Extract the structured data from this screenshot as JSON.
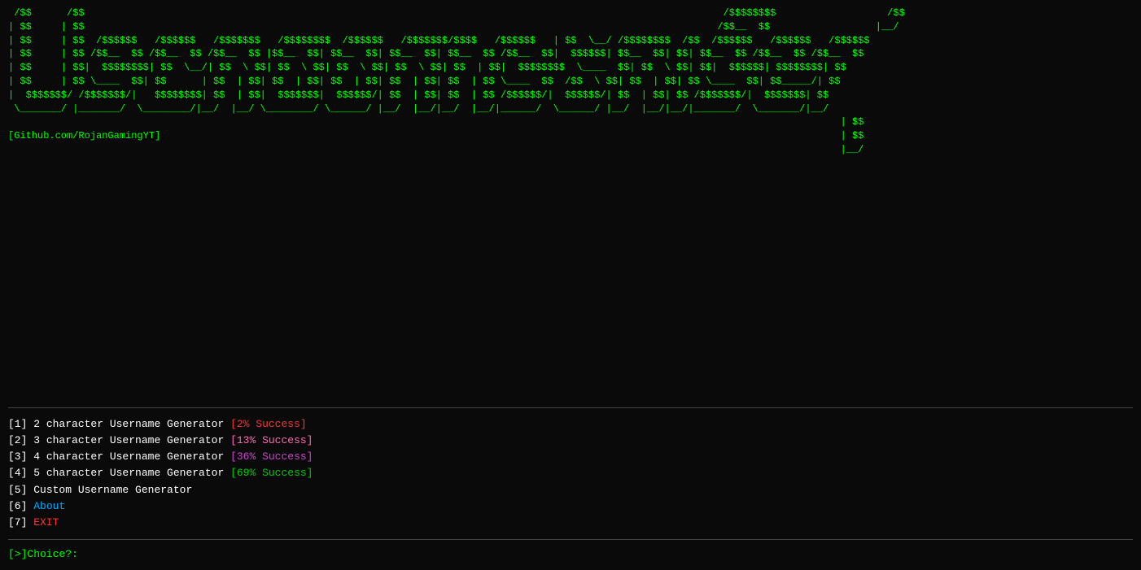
{
  "terminal": {
    "ascii_art": {
      "lines": [
        " /$$      /$$                                                                                                             /$$$$$$$$                   /$$  ",
        "| $$     | $$                                                                                                            /$$__  $$                  |__/  ",
        "| $$     | $$  /$$$$$$   /$$$$$$   /$$$$$$   /$$$$$$$$   /$$$$$$   /$$$$$$$/$$$$   /$$$$$$   |  $$  \\__/ /$$$$$$$$  /$$  /$$$$$$   /$$$$$$   /$$$$$$  ",
        "| $$     | $$ /$$__  $$ /$$__  $$ /$$__  $$ |$$__  $$| $$__  $$| $$__  $$| $$__  $$ /$$__  $$|  $$$$$$| $$__  $$| $$| $$__  $$ /$$__  $$ /$$__  $$",
        "| $$     | $$|  $$$$$$$$| $$  \\__/| $$  \\ $$| $$  \\ $$| $$  \\ $$| $$  | $$| $$  | $$|  $$$$$$$$  \\____  $$| $$  | $$| $$|  $$$$$$| $$$$$$$$| $$  \\__/",
        "| $$     | $$ \\____  $$| $$      | $$  | $$| $$  | $$| $$  | $$| $$  | $$| $$  | $$ \\____  $$  /$$  \\ $$| $$  | $$| $$ \\____  $$| $$_____/| $$      ",
        "|  $$$$$$$/ /$$$$$$$/|   $$$$$$$$| $$  | $$|  $$$$$$$|  $$$$$$/| $$  | $$| $$  | $$ /$$$$$$/|  $$$$$$/| $$  | $$| $$ /$$$$$$$/|  $$$$$$$| $$      ",
        " \\_______/ |_______/  \\________/|__/  |__/ \\________/ \\______/ |__/  |__/|__/  |__/|______/  \\______/ |__/  |__/|__/|_______/  \\_______/|__/      "
      ],
      "right_section": [
        "                                                                                                                                              | $$  ",
        "                                                                                                                                              | $$  ",
        "                                                                                                                                              |__/  "
      ]
    },
    "github": "[Github.com/RojanGamingYT]",
    "menu": {
      "items": [
        {
          "num": "1",
          "label": "2 character Username Generator",
          "success": "[2% Success]",
          "success_class": "success-2"
        },
        {
          "num": "2",
          "label": "3 character Username Generator",
          "success": "[13% Success]",
          "success_class": "success-13"
        },
        {
          "num": "3",
          "label": "4 character Username Generator",
          "success": "[36% Success]",
          "success_class": "success-36"
        },
        {
          "num": "4",
          "label": "5 character Username Generator",
          "success": "[69% Success]",
          "success_class": "success-69"
        },
        {
          "num": "5",
          "label": "Custom Username Generator",
          "success": "",
          "success_class": ""
        },
        {
          "num": "6",
          "label": "About",
          "success": "",
          "success_class": "menu-about"
        },
        {
          "num": "7",
          "label": "EXIT",
          "success": "",
          "success_class": "menu-exit"
        }
      ]
    },
    "prompt": "[>]",
    "choice_label": " Choice?: "
  }
}
